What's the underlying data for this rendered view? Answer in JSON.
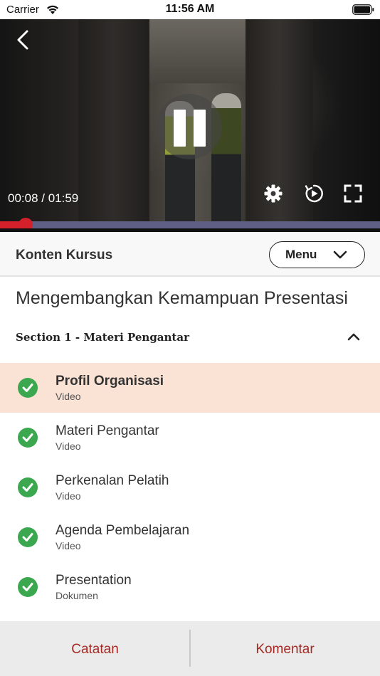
{
  "status_bar": {
    "carrier": "Carrier",
    "time": "11:56 AM"
  },
  "player": {
    "time_display": "00:08 / 01:59",
    "progress_fraction": 0.067,
    "icons": [
      "back-icon",
      "pause-icon",
      "gear-icon",
      "replay-icon",
      "fullscreen-icon"
    ]
  },
  "course_header": {
    "title": "Konten Kursus",
    "menu_label": "Menu"
  },
  "course_title": "Mengembangkan Kemampuan Presentasi",
  "section": {
    "title": "Section 1 - Materi Pengantar"
  },
  "lessons": [
    {
      "title": "Profil Organisasi",
      "type": "Video",
      "active": true
    },
    {
      "title": "Materi Pengantar",
      "type": "Video",
      "active": false
    },
    {
      "title": "Perkenalan Pelatih",
      "type": "Video",
      "active": false
    },
    {
      "title": "Agenda Pembelajaran",
      "type": "Video",
      "active": false
    },
    {
      "title": "Presentation",
      "type": "Dokumen",
      "active": false
    }
  ],
  "bottom_tabs": {
    "notes": "Catatan",
    "comments": "Komentar"
  },
  "colors": {
    "accent_red": "#d4202a",
    "tab_text": "#a42a24",
    "check_green": "#3ba84f",
    "active_row": "#fae3d5"
  }
}
